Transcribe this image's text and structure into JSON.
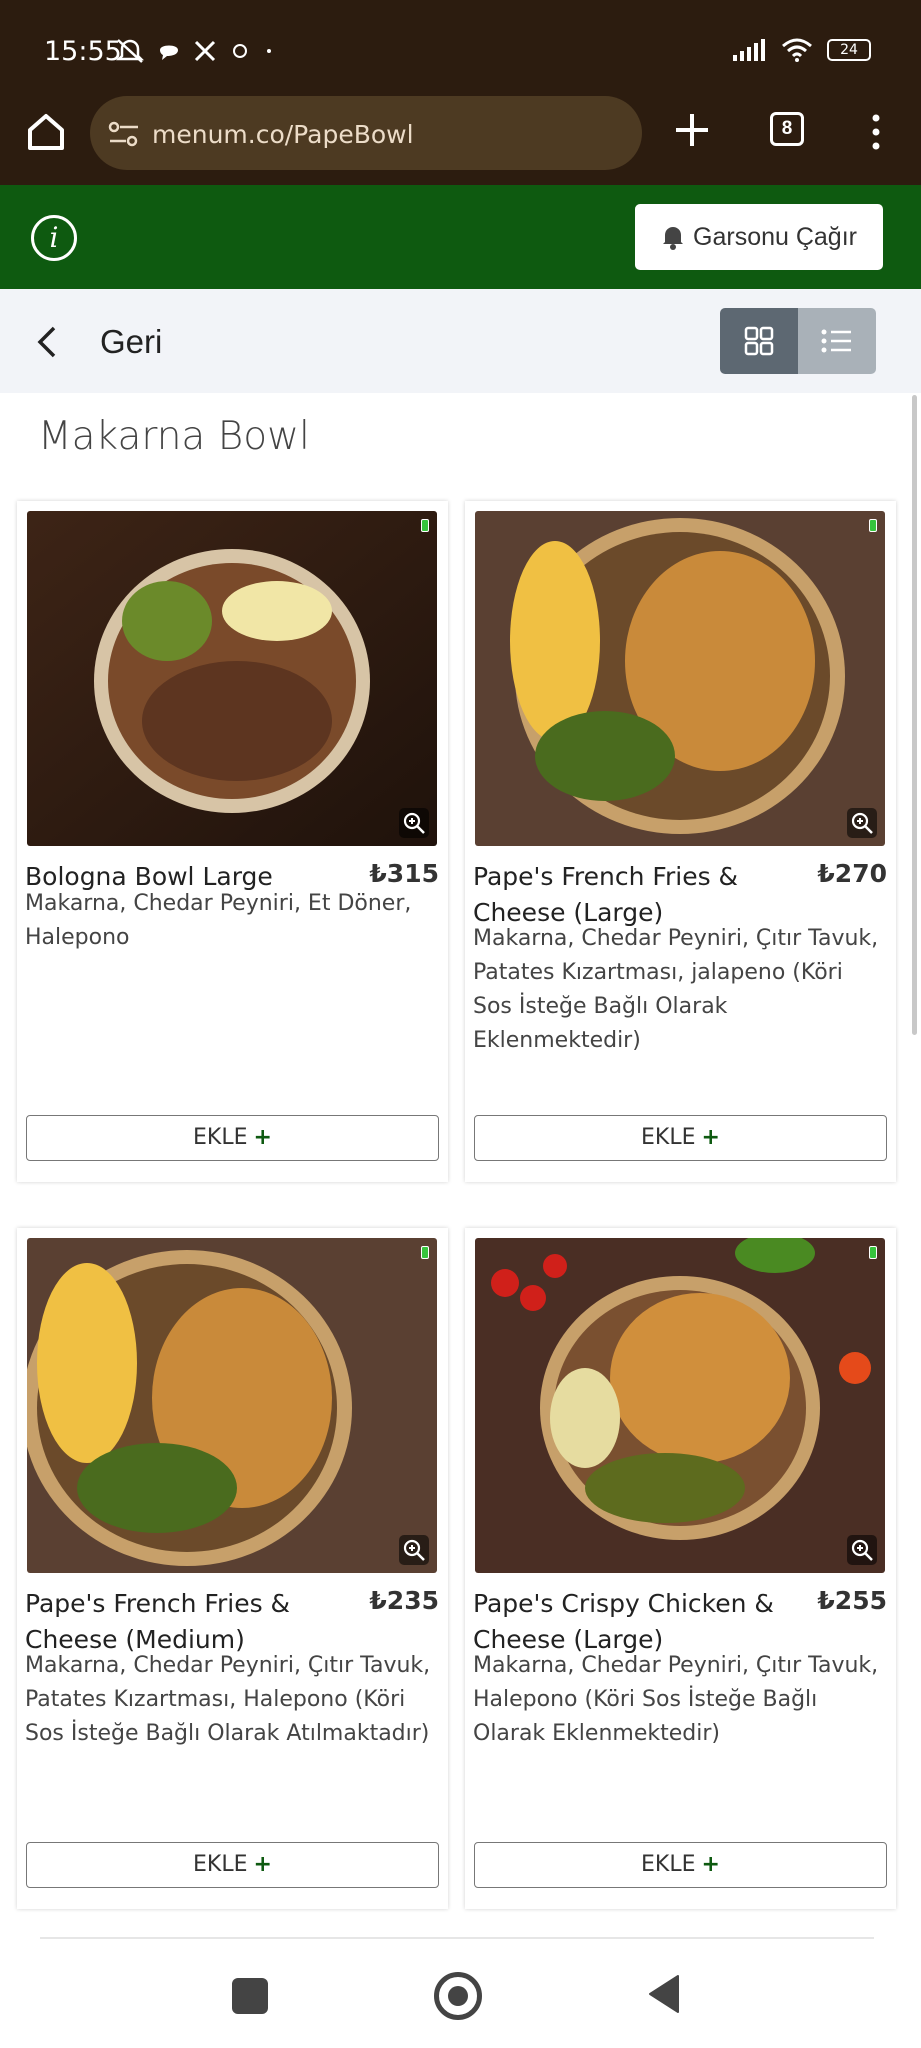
{
  "status_bar": {
    "time": "15:55",
    "battery": "24"
  },
  "browser": {
    "url": "menum.co/PapeBowl",
    "tab_count": "8"
  },
  "header": {
    "call_waiter_label": "Garsonu Çağır"
  },
  "nav": {
    "back_label": "Geri"
  },
  "section": {
    "title": "Makarna Bowl"
  },
  "products": [
    {
      "name": "Bologna Bowl Large",
      "price": "₺315",
      "description": "Makarna, Chedar Peyniri, Et Döner, Halepono",
      "add_label": "EKLE"
    },
    {
      "name": "Pape's French Fries & Cheese (Large)",
      "price": "₺270",
      "description": "Makarna, Chedar Peyniri, Çıtır Tavuk, Patates Kızartması, jalapeno (Köri Sos İsteğe Bağlı Olarak Eklenmektedir)",
      "add_label": "EKLE"
    },
    {
      "name": "Pape's French Fries & Cheese (Medium)",
      "price": "₺235",
      "description": "Makarna, Chedar Peyniri, Çıtır Tavuk, Patates Kızartması, Halepono (Köri Sos İsteğe Bağlı Olarak Atılmaktadır)",
      "add_label": "EKLE"
    },
    {
      "name": "Pape's Crispy Chicken & Cheese (Large)",
      "price": "₺255",
      "description": "Makarna, Chedar Peyniri, Çıtır Tavuk, Halepono (Köri Sos İsteğe Bağlı Olarak Eklenmektedir)",
      "add_label": "EKLE"
    }
  ],
  "icons": {
    "home": "home-icon",
    "site_settings": "tune-icon",
    "new_tab": "plus-icon",
    "menu": "more-vert-icon",
    "info": "info-icon",
    "bell": "bell-icon",
    "back": "chevron-left-icon",
    "grid_view": "grid-view-icon",
    "list_view": "list-view-icon",
    "zoom": "zoom-in-icon"
  },
  "colors": {
    "header_green": "#0e5a10",
    "browser_brown": "#2c1c0f",
    "add_plus": "#0e5a10"
  }
}
